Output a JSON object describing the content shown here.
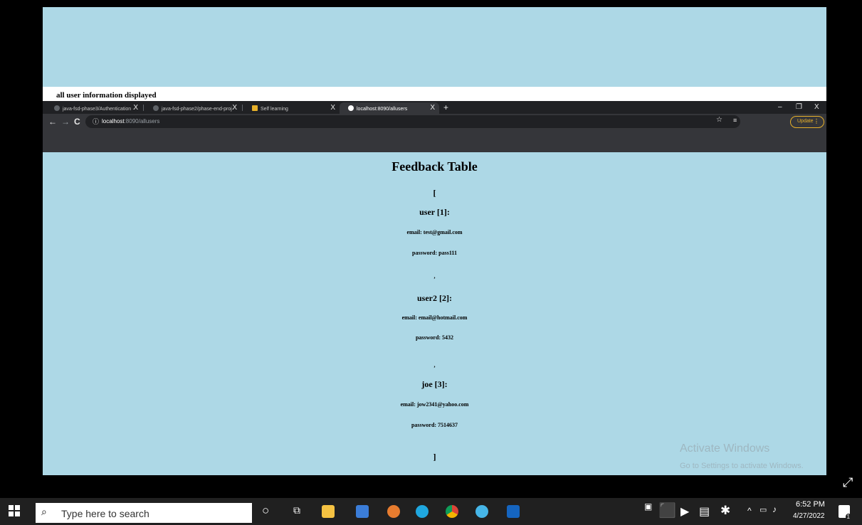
{
  "caption": "all user information displayed",
  "browser": {
    "tabs": [
      {
        "label": "java-fsd-phase3/Authentication ·",
        "close": "X"
      },
      {
        "label": "java-fsd-phase2/phase-end-proj·",
        "close": "X"
      },
      {
        "label": "Self learning",
        "close": "X"
      },
      {
        "label": "localhost:8090/allusers",
        "close": "X"
      }
    ],
    "new_tab": "+",
    "window_controls": [
      "–",
      "❐",
      "X"
    ],
    "url_host": "localhost",
    "url_rest": ":8090/allusers",
    "update_label": "Update",
    "update_menu": "⋮"
  },
  "content": {
    "title": "Feedback Table",
    "open_bracket": "[",
    "close_bracket": "]",
    "users": [
      {
        "heading": "user [1]:",
        "email": "email: test@gmail.com",
        "password": "password: pass111"
      },
      {
        "heading": "user2 [2]:",
        "email": "email: email@hotmail.com",
        "password": "password: 5432"
      },
      {
        "heading": "joe [3]:",
        "email": "email: jow2341@yahoo.com",
        "password": "password: 7514637"
      }
    ],
    "separator": ","
  },
  "watermark": {
    "line1": "Activate Windows",
    "line2": "Go to Settings to activate Windows."
  },
  "taskbar": {
    "search_placeholder": "Type here to search",
    "time": "6:52 PM",
    "date": "4/27/2022",
    "notification_count": "1",
    "icons": [
      "cortana-icon",
      "task-view-icon",
      "file-explorer-icon",
      "store-icon",
      "app-icon",
      "edge-icon",
      "chrome-icon",
      "chrome-canary-icon",
      "photos-icon"
    ]
  },
  "colors": {
    "page_bg": "#add8e6",
    "chrome_dark": "#202124",
    "chrome_toolbar": "#35363a",
    "update_accent": "#e8b12a"
  }
}
